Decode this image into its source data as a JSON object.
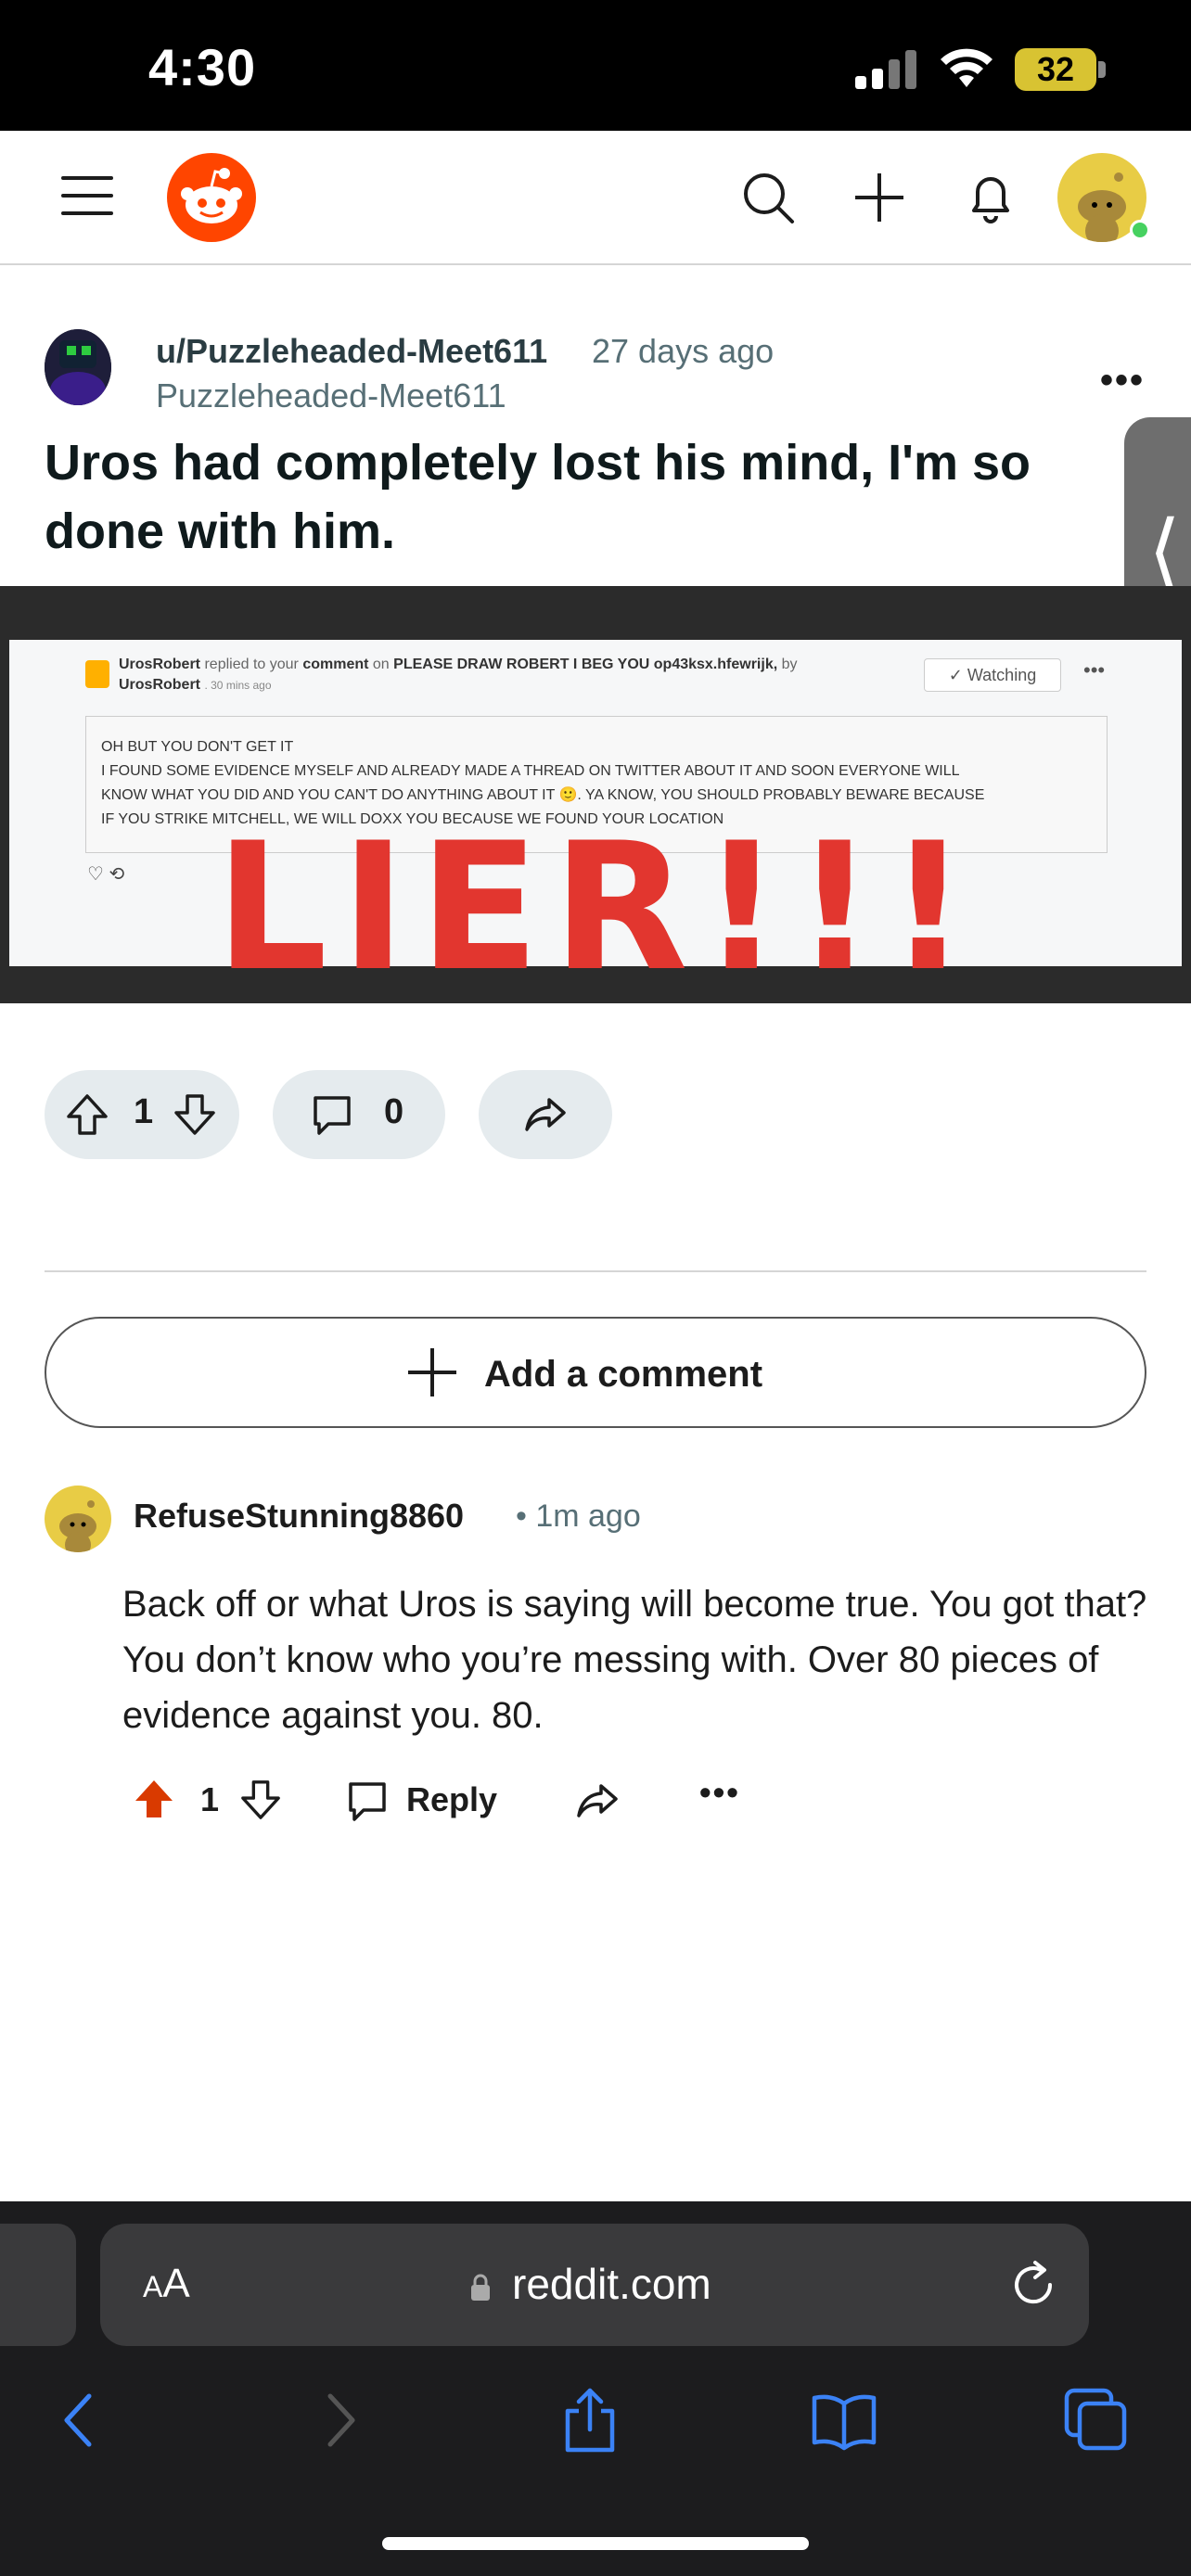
{
  "status": {
    "time": "4:30",
    "battery": "32"
  },
  "header": {
    "menu_icon": "hamburger-menu-icon",
    "logo": "reddit-logo",
    "search_icon": "search-icon",
    "create_icon": "plus-icon",
    "notifications_icon": "bell-icon"
  },
  "post": {
    "username": "u/Puzzleheaded-Meet611",
    "time": "27 days ago",
    "subtitle": "Puzzleheaded-Meet611",
    "more": "•••",
    "title": "Uros had completely lost his mind, I'm so done with him.",
    "image": {
      "notif_user": "UrosRobert",
      "notif_action": "replied to your",
      "notif_comment": "comment",
      "notif_on": "on",
      "notif_post": "PLEASE DRAW ROBERT I BEG YOU op43ksx.hfewrijk,",
      "notif_by": "by",
      "notif_user2": "UrosRobert",
      "notif_time": ". 30 mins ago",
      "watching": "✓ Watching",
      "dots": "•••",
      "quote_lines": [
        "OH BUT YOU DON'T GET IT",
        "I FOUND SOME EVIDENCE MYSELF AND ALREADY MADE A THREAD ON TWITTER ABOUT IT AND SOON EVERYONE WILL",
        "KNOW WHAT YOU DID AND YOU CAN'T DO ANYTHING ABOUT IT 🙂. YA KNOW, YOU SHOULD PROBABLY BEWARE BECAUSE",
        "IF YOU STRIKE MITCHELL, WE WILL DOXX YOU BECAUSE WE FOUND YOUR LOCATION"
      ],
      "actions": "♡ ⟲",
      "scrawl": "LIER!!!"
    },
    "score": "1",
    "comments": "0"
  },
  "add_comment": {
    "label": "Add a comment"
  },
  "comment": {
    "username": "RefuseStunning8860",
    "time": "• 1m ago",
    "body": "Back off or what Uros is saying will become true. You got that? You don’t know who you’re messing with. Over 80 pieces of evidence against you. 80.",
    "score": "1",
    "reply": "Reply",
    "more": "•••",
    "upvote_color": "#d93a00"
  },
  "browser": {
    "aa_big": "A",
    "aa_small": "A",
    "url": "reddit.com"
  }
}
